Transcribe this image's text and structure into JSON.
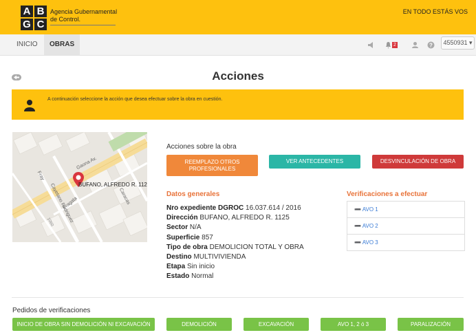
{
  "header": {
    "logo_letters": [
      "A",
      "B",
      "G",
      "C"
    ],
    "brand_line1": "Agencia Gubernamental",
    "brand_line2": "de Control.",
    "slogan": "EN TODO ESTÁS VOS"
  },
  "nav": {
    "tabs": [
      {
        "label": "INICIO"
      },
      {
        "label": "OBRAS"
      }
    ],
    "icons": [
      "megaphone-icon",
      "bell-icon",
      "user-icon",
      "help-icon"
    ],
    "notification_count": "2",
    "user_label": "4550931 ▾"
  },
  "page": {
    "title": "Acciones"
  },
  "alert": {
    "text": "A continuación seleccione la acción que desea efectuar sobre la obra en cuestión."
  },
  "map": {
    "labels": {
      "street_gaona": "Gaona Av.",
      "street_frey": "Fray",
      "street_cayetano": "Cayetano Rodriguez",
      "street_fragata": "Fragata",
      "street_caracas": "Caracas",
      "street_1060": "1060",
      "marker_address": "BUFANO, ALFREDO R. 1125"
    }
  },
  "actions": {
    "label": "Acciones sobre la obra",
    "buttons": [
      {
        "label": "REEMPLAZO OTROS PROFESIONALES"
      },
      {
        "label": "VER ANTECEDENTES"
      },
      {
        "label": "DESVINCULACIÓN DE OBRA"
      }
    ]
  },
  "datos": {
    "title": "Datos generales",
    "fields": [
      {
        "label": "Nro expediente DGROC",
        "value": "16.037.614 / 2016"
      },
      {
        "label": "Dirección",
        "value": "BUFANO, ALFREDO R. 1125"
      },
      {
        "label": "Sector",
        "value": "N/A"
      },
      {
        "label": "Superficie",
        "value": "857"
      },
      {
        "label": "Tipo de obra",
        "value": "DEMOLICION TOTAL Y OBRA"
      },
      {
        "label": "Destino",
        "value": "MULTIVIVIENDA"
      },
      {
        "label": "Etapa",
        "value": "Sin inicio"
      },
      {
        "label": "Estado",
        "value": "Normal"
      }
    ]
  },
  "verificaciones": {
    "title": "Verificaciones a efectuar",
    "items": [
      {
        "label": "AVO 1"
      },
      {
        "label": "AVO 2"
      },
      {
        "label": "AVO 3"
      }
    ]
  },
  "pedidos": {
    "label": "Pedidos de verificaciones",
    "buttons": [
      {
        "label": "INICIO DE OBRA SIN DEMOLICIÓN NI EXCAVACIÓN"
      },
      {
        "label": "DEMOLICIÓN"
      },
      {
        "label": "EXCAVACIÓN"
      },
      {
        "label": "AVO 1, 2 ó 3"
      },
      {
        "label": "PARALIZACIÓN"
      }
    ]
  },
  "colors": {
    "brand_yellow": "#fec10e",
    "orange": "#f0883a",
    "teal": "#2bb6a6",
    "red": "#cf3a3a",
    "green": "#79c347",
    "link_blue": "#3a7bd5"
  }
}
